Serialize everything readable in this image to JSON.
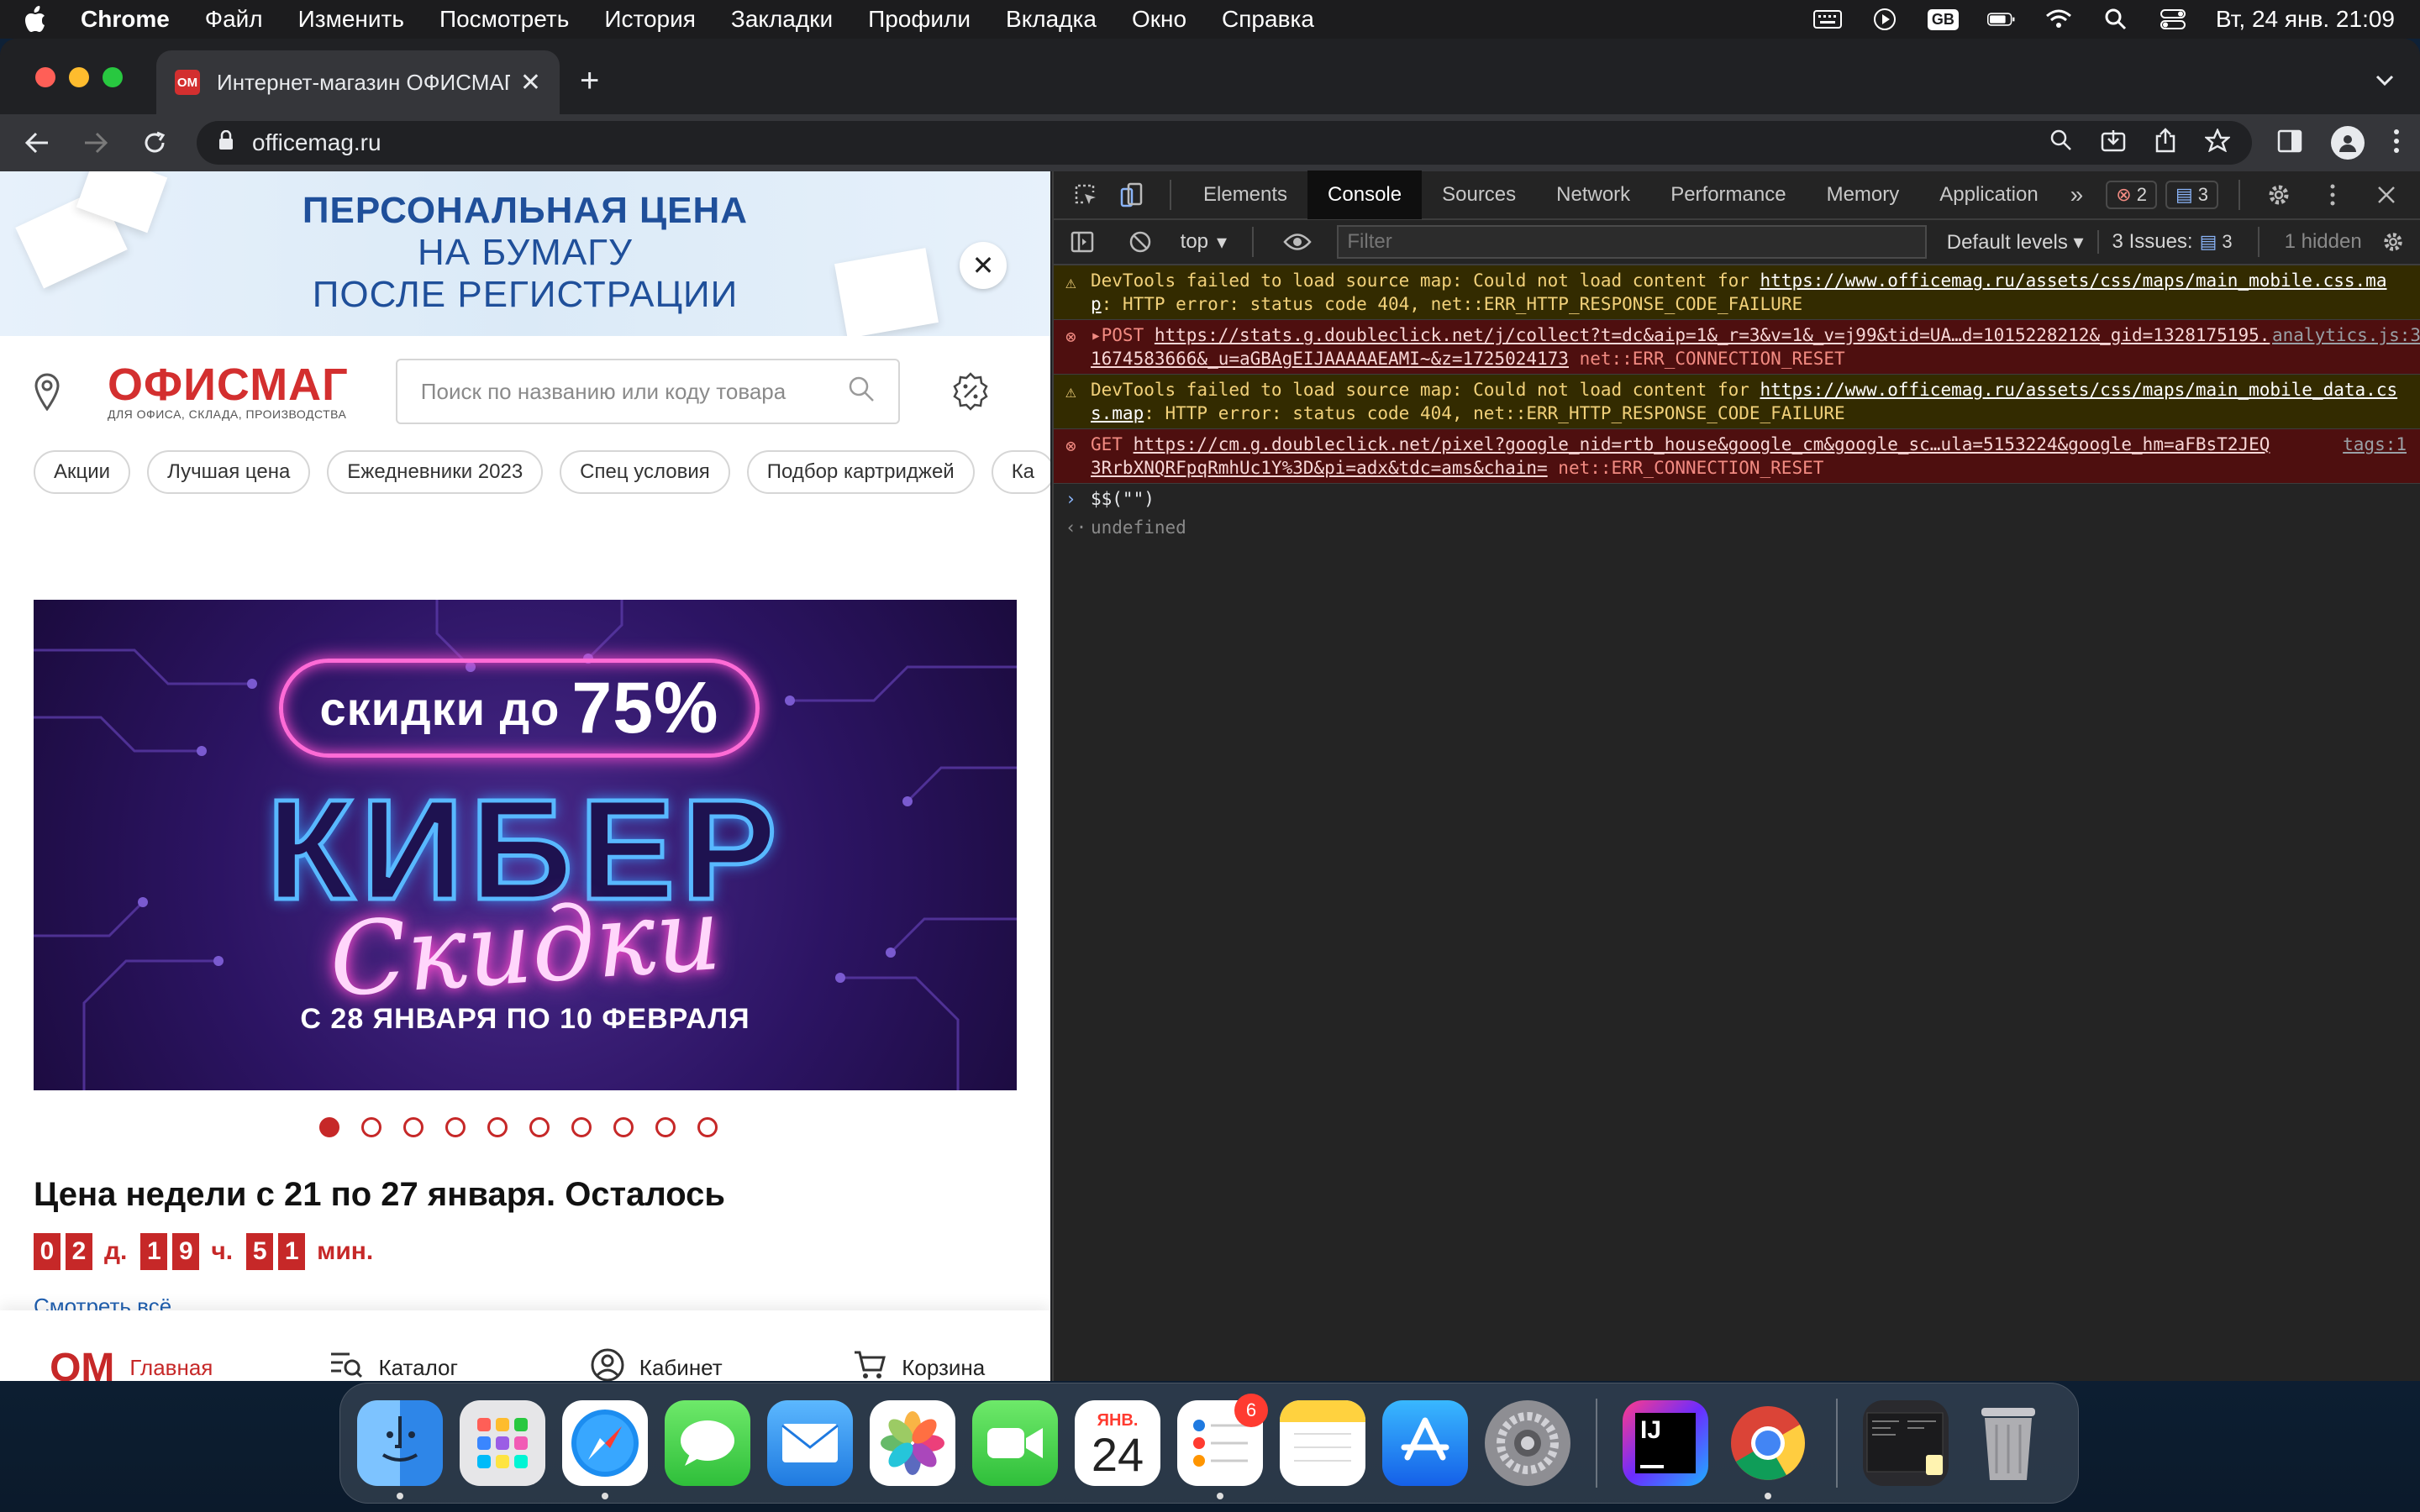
{
  "menubar": {
    "items": [
      "Chrome",
      "Файл",
      "Изменить",
      "Посмотреть",
      "История",
      "Закладки",
      "Профили",
      "Вкладка",
      "Окно",
      "Справка"
    ],
    "input_source": "GB",
    "clock": "Вт, 24 янв.  21:09"
  },
  "browser": {
    "tab_title": "Интернет-магазин ОФИСМАГ",
    "favicon_text": "OM",
    "url": "officemag.ru"
  },
  "page": {
    "promo": {
      "lines": [
        "ПЕРСОНАЛЬНАЯ ЦЕНА",
        "НА БУМАГУ",
        "ПОСЛЕ РЕГИСТРАЦИИ"
      ]
    },
    "logo": {
      "name": "ОФИСМАГ",
      "tagline": "ДЛЯ ОФИСА, СКЛАДА, ПРОИЗВОДСТВА"
    },
    "search": {
      "placeholder": "Поиск по названию или коду товара"
    },
    "chips": [
      "Акции",
      "Лучшая цена",
      "Ежедневники 2023",
      "Спец условия",
      "Подбор картриджей",
      "Ка"
    ],
    "banner": {
      "pill_text": "скидки до",
      "pill_value": "75%",
      "title": "КИБЕР",
      "script": "Скидки",
      "dates": "С 28 ЯНВАРЯ ПО 10 ФЕВРАЛЯ"
    },
    "slider": {
      "total": 10,
      "active_index": 0
    },
    "week": {
      "title": "Цена недели с 21 по 27 января. Осталось",
      "days": [
        "0",
        "2"
      ],
      "days_unit": "д.",
      "hours": [
        "1",
        "9"
      ],
      "hours_unit": "ч.",
      "minutes": [
        "5",
        "1"
      ],
      "minutes_unit": "мин.",
      "see_all": "Смотреть всё"
    },
    "bottom_nav": {
      "logo": "ОМ",
      "items": [
        "Главная",
        "Каталог",
        "Кабинет",
        "Корзина"
      ]
    }
  },
  "devtools": {
    "tabs": [
      "Elements",
      "Console",
      "Sources",
      "Network",
      "Performance",
      "Memory",
      "Application"
    ],
    "active_tab": "Console",
    "error_count": "2",
    "info_count": "3",
    "context": "top",
    "filter_placeholder": "Filter",
    "levels": "Default levels",
    "issues_label": "3 Issues:",
    "issues_count": "3",
    "hidden": "1 hidden",
    "messages": [
      {
        "level": "warn",
        "prefix": "DevTools failed to load source map: Could not load content for ",
        "link": "https://www.officemag.ru/assets/css/maps/main_mobile.css.map",
        "suffix": ": HTTP error: status code 404, net::ERR_HTTP_RESPONSE_CODE_FAILURE",
        "source": ""
      },
      {
        "level": "error",
        "prefix": "▸POST ",
        "link": "https://stats.g.doubleclick.net/j/collect?t=dc&aip=1&_r=3&v=1&_v=j99&tid=UA…d=1015228212&_gid=1328175195.1674583666&_u=aGBAgEIJAAAAAEAMI~&z=1725024173",
        "suffix": " net::ERR_CONNECTION_RESET",
        "source": "analytics.js:34"
      },
      {
        "level": "warn",
        "prefix": "DevTools failed to load source map: Could not load content for ",
        "link": "https://www.officemag.ru/assets/css/maps/main_mobile_data.css.map",
        "suffix": ": HTTP error: status code 404, net::ERR_HTTP_RESPONSE_CODE_FAILURE",
        "source": ""
      },
      {
        "level": "error",
        "prefix": "GET ",
        "link": "https://cm.g.doubleclick.net/pixel?google_nid=rtb_house&google_cm&google_sc…ula=5153224&google_hm=aFBsT2JEQ3RrbXNQRFpqRmhUc1Y%3D&pi=adx&tdc=ams&chain=",
        "suffix": " net::ERR_CONNECTION_RESET",
        "source": "tags:1"
      }
    ],
    "input": "$$(\"\")",
    "result": "undefined"
  },
  "dock": {
    "apps": [
      "Finder",
      "Launchpad",
      "Safari",
      "Messages",
      "Mail",
      "Photos",
      "FaceTime",
      "Calendar",
      "Reminders",
      "Notes",
      "App Store",
      "System Preferences",
      "IntelliJ IDEA",
      "Google Chrome",
      "Downloads",
      "Trash"
    ],
    "calendar_month": "ЯНВ.",
    "calendar_day": "24",
    "reminders_badge": "6"
  }
}
